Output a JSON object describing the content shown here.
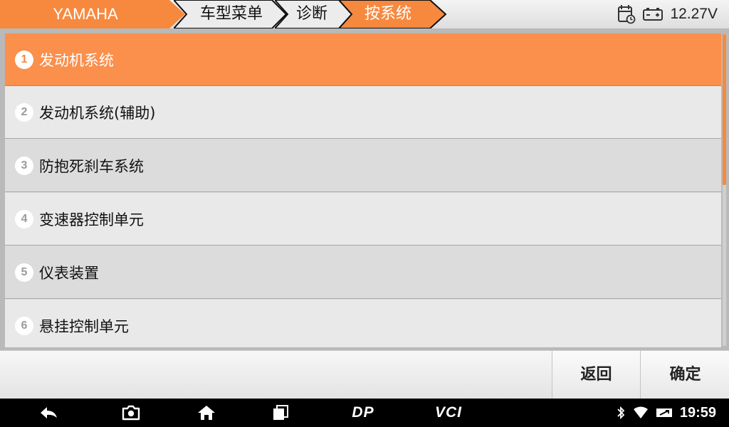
{
  "breadcrumbs": [
    {
      "label": "YAMAHA"
    },
    {
      "label": "车型菜单"
    },
    {
      "label": "诊断"
    },
    {
      "label": "按系统"
    }
  ],
  "status": {
    "voltage": "12.27V",
    "calendar_icon": "calendar-icon",
    "battery_icon": "battery-icon"
  },
  "systems": [
    {
      "num": "1",
      "label": "发动机系统"
    },
    {
      "num": "2",
      "label": "发动机系统(辅助)"
    },
    {
      "num": "3",
      "label": "防抱死刹车系统"
    },
    {
      "num": "4",
      "label": "变速器控制单元"
    },
    {
      "num": "5",
      "label": "仪表装置"
    },
    {
      "num": "6",
      "label": "悬挂控制单元"
    }
  ],
  "actions": {
    "back": "返回",
    "confirm": "确定"
  },
  "nav": {
    "dp": "DP",
    "vci": "VCI"
  },
  "system_tray": {
    "time": "19:59"
  },
  "colors": {
    "accent": "#f7893f",
    "selected_row": "#fb8f4c"
  }
}
